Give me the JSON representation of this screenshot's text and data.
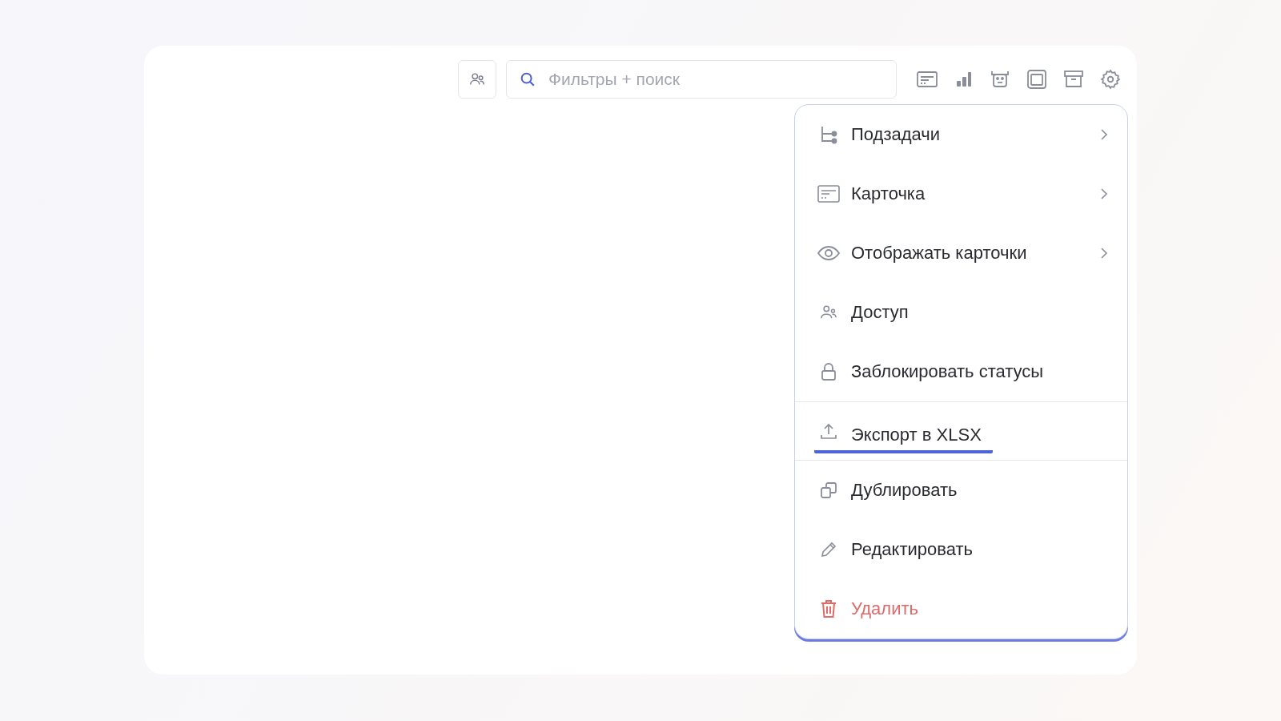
{
  "toolbar": {
    "search": {
      "placeholder": "Фильтры + поиск"
    }
  },
  "menu": {
    "groups": [
      [
        {
          "label": "Подзадачи",
          "has_submenu": true,
          "selected": false,
          "kind": "normal"
        },
        {
          "label": "Карточка",
          "has_submenu": true,
          "selected": false,
          "kind": "normal"
        },
        {
          "label": "Отображать карточки",
          "has_submenu": true,
          "selected": false,
          "kind": "normal"
        },
        {
          "label": "Доступ",
          "has_submenu": false,
          "selected": false,
          "kind": "normal"
        },
        {
          "label": "Заблокировать статусы",
          "has_submenu": false,
          "selected": false,
          "kind": "normal"
        }
      ],
      [
        {
          "label": "Экспорт в XLSX",
          "has_submenu": false,
          "selected": true,
          "kind": "normal"
        }
      ],
      [
        {
          "label": "Дублировать",
          "has_submenu": false,
          "selected": false,
          "kind": "normal"
        },
        {
          "label": "Редактировать",
          "has_submenu": false,
          "selected": false,
          "kind": "normal"
        },
        {
          "label": "Удалить",
          "has_submenu": false,
          "selected": false,
          "kind": "danger"
        }
      ]
    ]
  }
}
